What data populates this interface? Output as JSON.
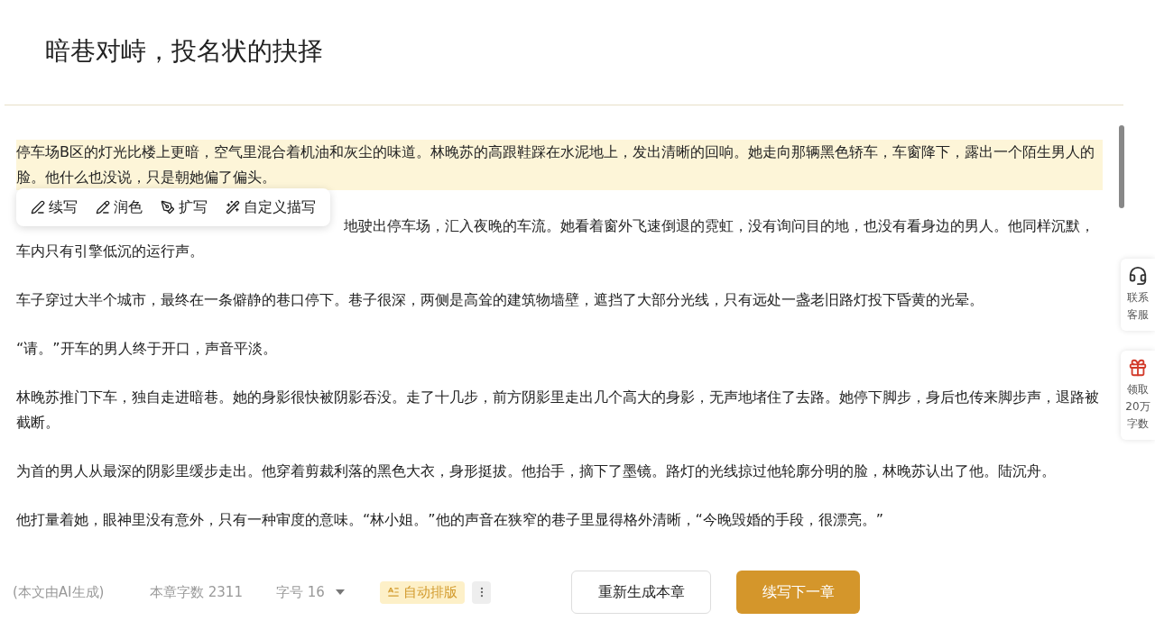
{
  "title": "暗巷对峙，投名状的抉择",
  "paragraphs": [
    {
      "text": "停车场B区的灯光比楼上更暗，空气里混合着机油和灰尘的味道。林晚苏的高跟鞋踩在水泥地上，发出清晰的回响。她走向那辆黑色轿车，车窗降下，露出一个陌生男人的脸。他什么也没说，只是朝她偏了偏头。",
      "highlighted": true
    },
    {
      "text": "地驶出停车场，汇入夜晚的车流。她看着窗外飞速倒退的霓虹，没有询问目的地，也没有看身边的男人。他同样沉默，车内只有引擎低沉的运行声。",
      "highlighted": false
    },
    {
      "text": "车子穿过大半个城市，最终在一条僻静的巷口停下。巷子很深，两侧是高耸的建筑物墙壁，遮挡了大部分光线，只有远处一盏老旧路灯投下昏黄的光晕。",
      "highlighted": false
    },
    {
      "text": "“请。”开车的男人终于开口，声音平淡。",
      "highlighted": false
    },
    {
      "text": "林晚苏推门下车，独自走进暗巷。她的身影很快被阴影吞没。走了十几步，前方阴影里走出几个高大的身影，无声地堵住了去路。她停下脚步，身后也传来脚步声，退路被截断。",
      "highlighted": false
    },
    {
      "text": "为首的男人从最深的阴影里缓步走出。他穿着剪裁利落的黑色大衣，身形挺拔。他抬手，摘下了墨镜。路灯的光线掠过他轮廓分明的脸，林晚苏认出了他。陆沉舟。",
      "highlighted": false
    },
    {
      "text": "他打量着她，眼神里没有意外，只有一种审度的意味。“林小姐。”他的声音在狭窄的巷子里显得格外清晰，“今晚毁婚的手段，很漂亮。”",
      "highlighted": false
    }
  ],
  "toolbar": [
    {
      "kind": "continue",
      "label": "续写"
    },
    {
      "kind": "polish",
      "label": "润色"
    },
    {
      "kind": "expand",
      "label": "扩写"
    },
    {
      "kind": "custom",
      "label": "自定义描写"
    }
  ],
  "side_widgets": [
    {
      "kind": "support",
      "lines": [
        "联系",
        "客服"
      ]
    },
    {
      "kind": "gift",
      "lines": [
        "领取",
        "20万",
        "字数"
      ]
    }
  ],
  "footer": {
    "note": "(本文由AI生成)",
    "word_count": "本章字数 2311",
    "font_size": "字号 16",
    "auto_layout": "自动排版",
    "regenerate": "重新生成本章",
    "continue": "续写下一章"
  }
}
